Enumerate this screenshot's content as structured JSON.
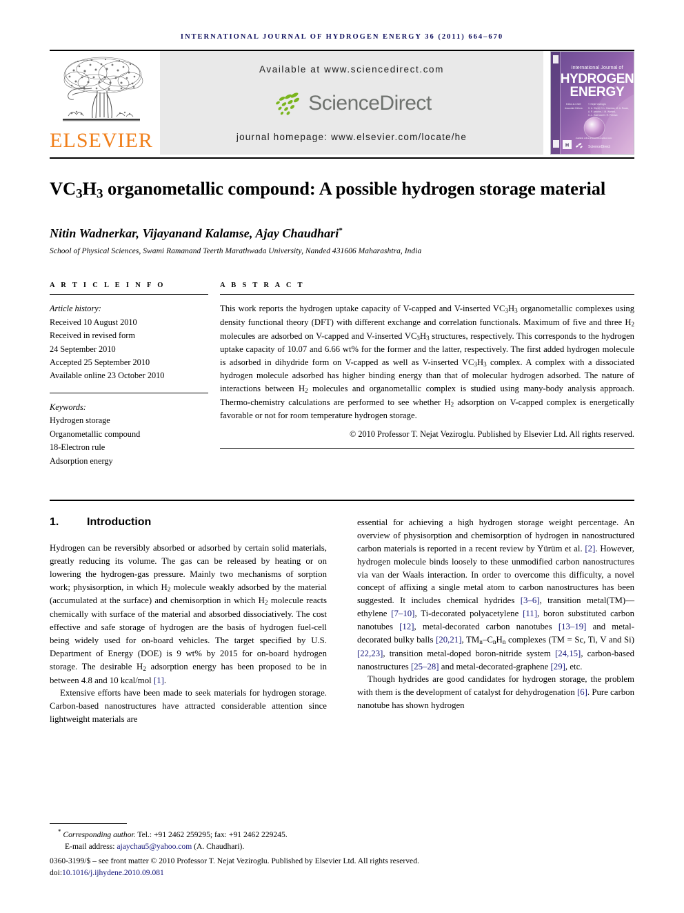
{
  "running_head": "INTERNATIONAL JOURNAL OF HYDROGEN ENERGY 36 (2011) 664–670",
  "masthead": {
    "publisher_logo_text": "ELSEVIER",
    "publisher_logo_icon": "elsevier-tree-icon",
    "available_at": "Available at www.sciencedirect.com",
    "sciencedirect_word": "ScienceDirect",
    "sciencedirect_icon": "sciencedirect-leaves-icon",
    "journal_homepage": "journal homepage: www.elsevier.com/locate/he",
    "cover": {
      "line1": "International Journal of",
      "line2": "HYDROGEN",
      "line3": "ENERGY",
      "editor_label": "Editor-in-Chief:",
      "editor_name": "T. Nejat Veziroglu",
      "assoc_label": "Associate Editors:",
      "assoc_names": "S. A. Sherif, D. L. Damdas, M. A. Rosen, A. P. Amorim, I. M. Warlind, C.-L. Gadi and D. R. Petrovic",
      "footer_brand": "ScienceDirect",
      "footer_note": "Available online at www.sciencedirect.com",
      "hexagon_icon": "iahe-hexagon-icon",
      "elsevier_mark_icon": "elsevier-cover-mark-icon"
    }
  },
  "article": {
    "title_parts": [
      "VC",
      "3",
      "H",
      "3",
      " organometallic compound: A possible hydrogen storage material"
    ],
    "title_plain": "VC3H3 organometallic compound: A possible hydrogen storage material",
    "authors": "Nitin Wadnerkar, Vijayanand Kalamse, Ajay Chaudhari",
    "author_marker": "*",
    "affiliation": "School of Physical Sciences, Swami Ramanand Teerth Marathwada University, Nanded 431606 Maharashtra, India"
  },
  "article_info": {
    "heading": "A R T I C L E   I N F O",
    "history_label": "Article history:",
    "history": [
      "Received 10 August 2010",
      "Received in revised form",
      "24 September 2010",
      "Accepted 25 September 2010",
      "Available online 23 October 2010"
    ],
    "keywords_label": "Keywords:",
    "keywords": [
      "Hydrogen storage",
      "Organometallic compound",
      "18-Electron rule",
      "Adsorption energy"
    ]
  },
  "abstract": {
    "heading": "A B S T R A C T",
    "copyright": "© 2010 Professor T. Nejat Veziroglu. Published by Elsevier Ltd. All rights reserved."
  },
  "introduction": {
    "number": "1.",
    "heading": "Introduction"
  },
  "footnote": {
    "star": "*",
    "corresponding_label": "Corresponding author.",
    "tel_fax": "Tel.: +91 2462 259295; fax: +91 2462 229245.",
    "email_label": "E-mail address:",
    "email": "ajaychau5@yahoo.com",
    "email_owner": "(A. Chaudhari).",
    "issn_line": "0360-3199/$ – see front matter © 2010 Professor T. Nejat Veziroglu. Published by Elsevier Ltd. All rights reserved.",
    "doi_label": "doi:",
    "doi": "10.1016/j.ijhydene.2010.09.081"
  },
  "colors": {
    "running_head": "#0d0d5c",
    "elsevier_orange": "#F07F1A",
    "sciencedirect_gray": "#6e726e",
    "sciencedirect_green": "#7ab51d",
    "reference_link": "#15167a",
    "banner_bg": "#e9e9e9"
  }
}
